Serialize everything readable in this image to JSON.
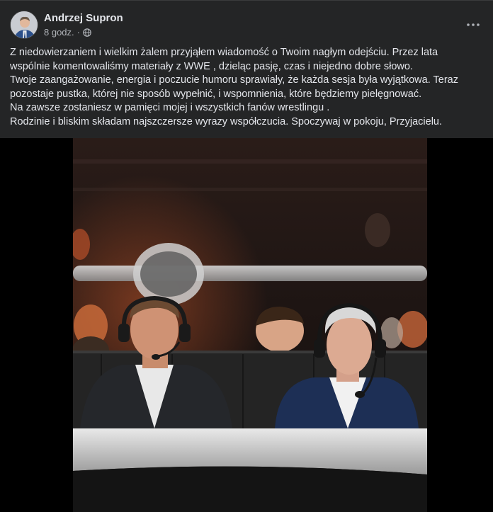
{
  "post": {
    "author": "Andrzej Supron",
    "time": "8 godz.",
    "separator": "·",
    "more_label": "•••",
    "lines": [
      "Z niedowierzaniem i wielkim żalem przyjąłem wiadomość o Twoim nagłym odejściu. Przez lata",
      "wspólnie komentowaliśmy materiały z WWE , dzieląc pasję, czas i niejedno dobre słowo.",
      "Twoje zaangażowanie, energia i poczucie humoru sprawiały, że każda sesja była wyjątkowa. Teraz",
      "pozostaje pustka, której nie sposób wypełnić, i wspomnienia, które będziemy pielęgnować.",
      "Na zawsze zostaniesz w pamięci mojej i wszystkich fanów wrestlingu .",
      "Rodzinie i bliskim składam najszczersze wyrazy współczucia. Spoczywaj w pokoju, Przyjacielu."
    ]
  },
  "colors": {
    "background": "#18191a",
    "card": "#242526",
    "text_primary": "#e4e6eb",
    "text_secondary": "#b0b3b8"
  },
  "icons": {
    "privacy": "globe-icon",
    "more": "more-options-icon"
  }
}
